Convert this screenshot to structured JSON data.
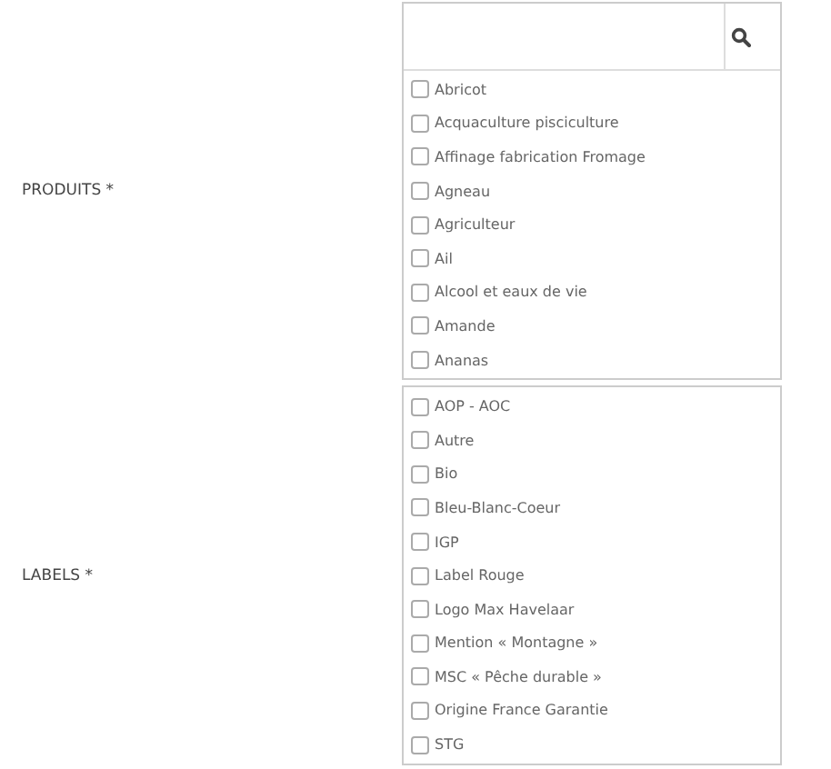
{
  "fields": [
    {
      "label": "PRODUITS *",
      "kind": "searchable",
      "options": [
        {
          "label": "Abricot",
          "checked": false
        },
        {
          "label": "Acquaculture pisciculture",
          "checked": false
        },
        {
          "label": "Affinage fabrication Fromage",
          "checked": false
        },
        {
          "label": "Agneau",
          "checked": false
        },
        {
          "label": "Agriculteur",
          "checked": false
        },
        {
          "label": "Ail",
          "checked": false
        },
        {
          "label": "Alcool et eaux de vie",
          "checked": false
        },
        {
          "label": "Amande",
          "checked": false
        },
        {
          "label": "Ananas",
          "checked": false
        }
      ]
    },
    {
      "label": "LABELS *",
      "kind": "plain",
      "options": [
        {
          "label": "AOP - AOC",
          "checked": false
        },
        {
          "label": "Autre",
          "checked": false
        },
        {
          "label": "Bio",
          "checked": false
        },
        {
          "label": "Bleu-Blanc-Coeur",
          "checked": false
        },
        {
          "label": "IGP",
          "checked": false
        },
        {
          "label": "Label Rouge",
          "checked": false
        },
        {
          "label": "Logo Max Havelaar",
          "checked": false
        },
        {
          "label": "Mention « Montagne »",
          "checked": false
        },
        {
          "label": "MSC « Pêche durable »",
          "checked": false
        },
        {
          "label": "Origine France Garantie",
          "checked": false
        },
        {
          "label": "STG",
          "checked": false
        }
      ]
    }
  ]
}
